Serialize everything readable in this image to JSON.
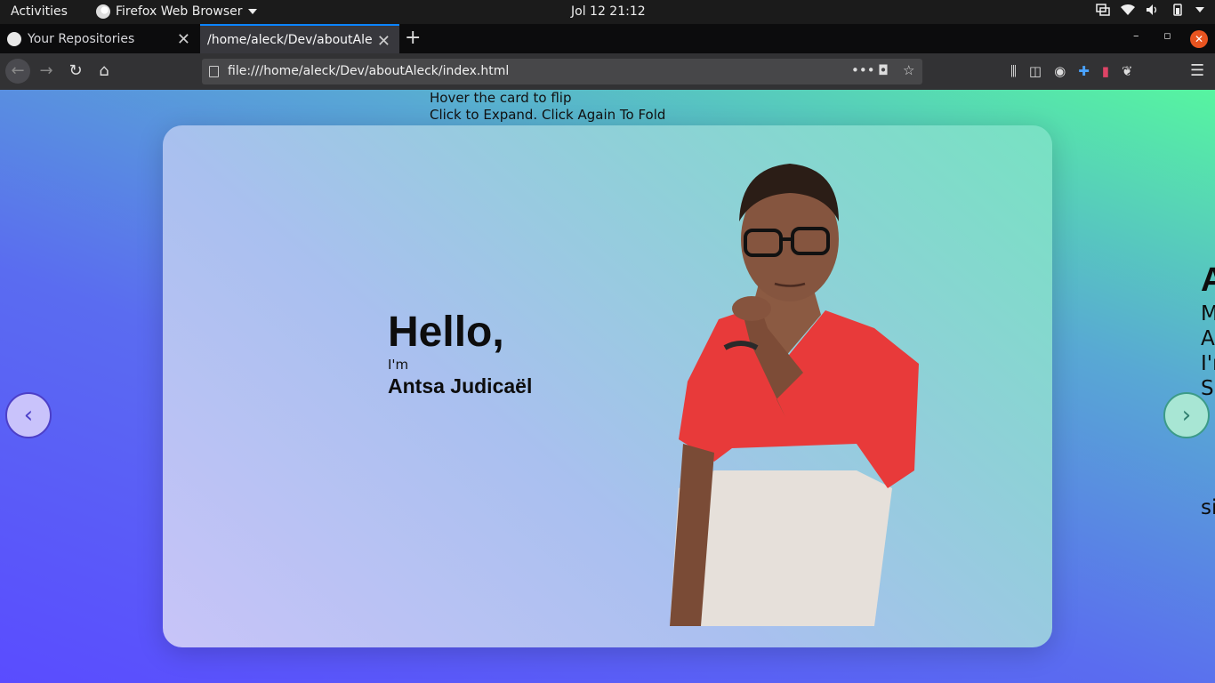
{
  "topbar": {
    "activities": "Activities",
    "app_name": "Firefox Web Browser",
    "clock": "Jol 12  21:12"
  },
  "tabs": [
    {
      "label": "Your Repositories"
    },
    {
      "label": "/home/aleck/Dev/aboutAleck"
    }
  ],
  "navbar": {
    "url": "file:///home/aleck/Dev/aboutAleck/index.html"
  },
  "page": {
    "hint_line1": "Hover the card to flip",
    "hint_line2": "Click to Expand. Click Again To Fold",
    "hello": "Hello,",
    "im": "I'm",
    "name": "Antsa Judicaël",
    "peek": [
      "A",
      "M",
      "A",
      "I'r",
      "Sl",
      "si"
    ]
  },
  "colors": {
    "accent_tab": "#0a84ff",
    "close_button": "#e95420",
    "bg_start": "#5a4cff",
    "bg_end": "#56f5a0"
  }
}
